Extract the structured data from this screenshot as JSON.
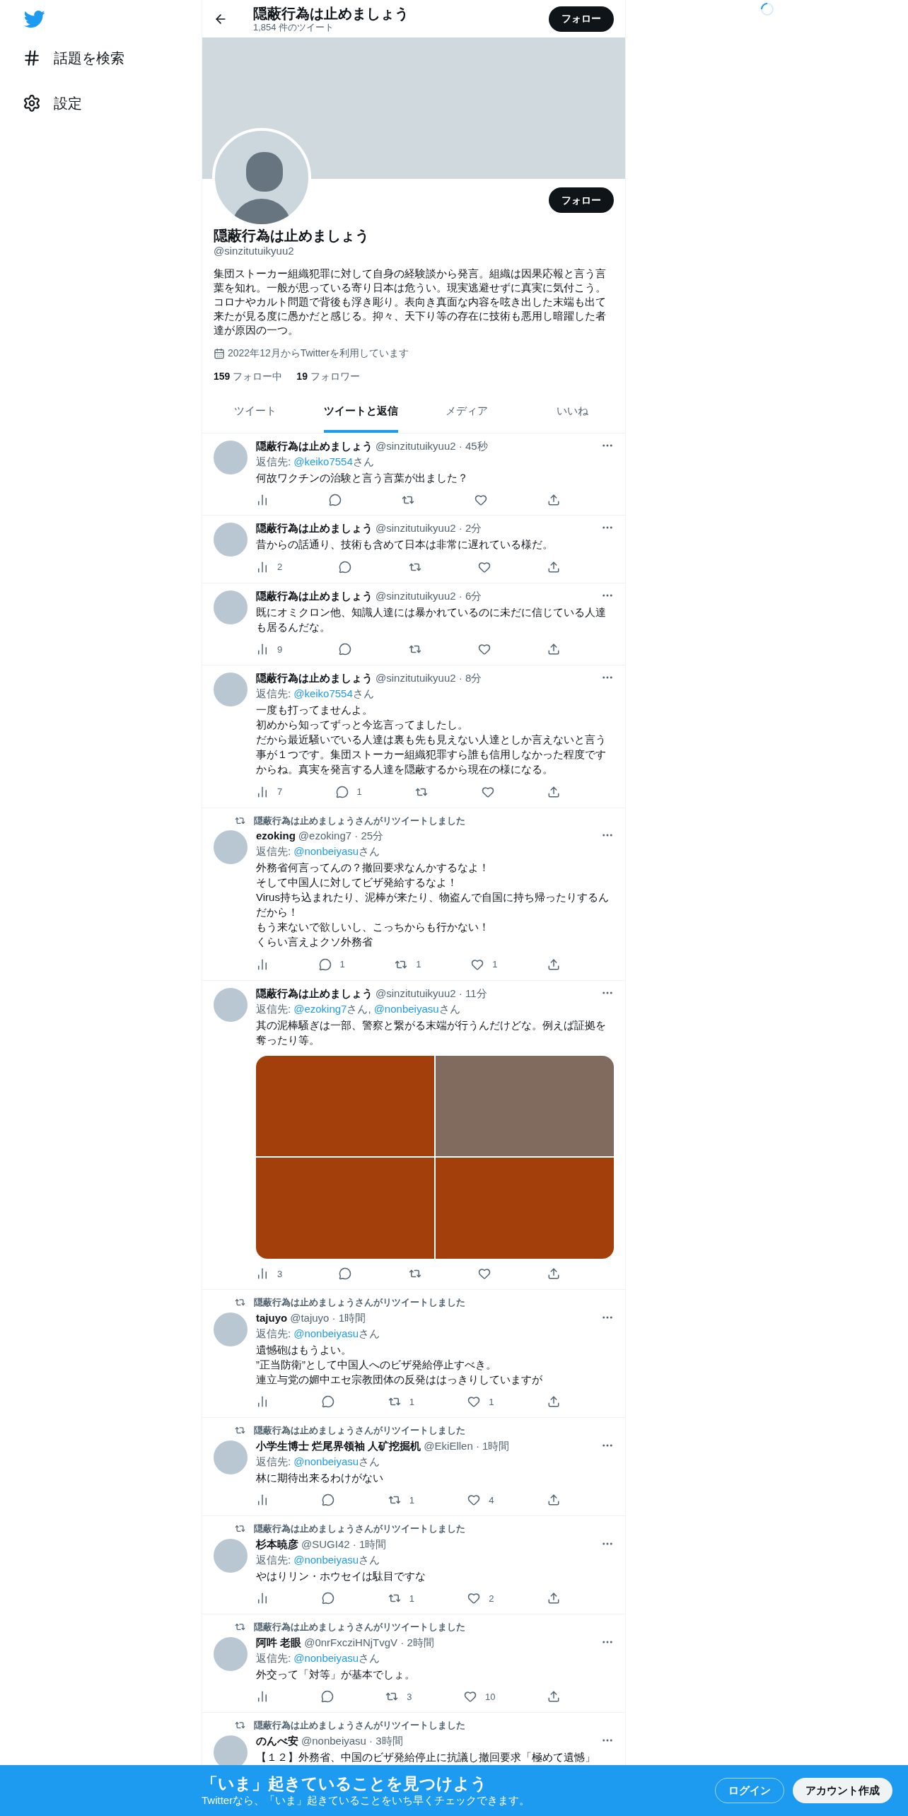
{
  "sidebar": {
    "items": [
      {
        "kind": "hashtag",
        "label": "話題を検索"
      },
      {
        "kind": "settings",
        "label": "設定"
      }
    ]
  },
  "header": {
    "title": "隠蔽行為は止めましょう",
    "tweet_count": "1,854 件のツイート",
    "follow_button": "フォロー"
  },
  "profile": {
    "follow_button": "フォロー",
    "name": "隠蔽行為は止めましょう",
    "handle": "@sinzitutuikyuu2",
    "bio": "集団ストーカー組織犯罪に対して自身の経験談から発言。組織は因果応報と言う言葉を知れ。一般が思っている寄り日本は危うい。現実逃避せずに真実に気付こう。コロナやカルト問題で背後も浮き彫り。表向き真面な内容を呟き出した末端も出て来たが見る度に愚かだと感じる。抑々、天下り等の存在に技術も悪用し暗躍した者達が原因の一つ。",
    "joined": "2022年12月からTwitterを利用しています",
    "following_count": "159",
    "following_label": "フォロー中",
    "followers_count": "19",
    "followers_label": "フォロワー"
  },
  "tabs": [
    {
      "label": "ツイート",
      "selected": false
    },
    {
      "label": "ツイートと返信",
      "selected": true
    },
    {
      "label": "メディア",
      "selected": false
    },
    {
      "label": "いいね",
      "selected": false
    }
  ],
  "tweets": [
    {
      "name": "隠蔽行為は止めましょう",
      "meta": "@sinzitutuikyuu2 · 45秒",
      "reply_label": "返信先:",
      "reply_to": [
        {
          "handle": "@keiko7554",
          "suffix": "さん"
        }
      ],
      "text": "何故ワクチンの治験と言う言葉が出ました？",
      "actions": [
        {
          "kind": "views"
        },
        {
          "kind": "reply"
        },
        {
          "kind": "retweet"
        },
        {
          "kind": "like"
        },
        {
          "kind": "share"
        }
      ]
    },
    {
      "name": "隠蔽行為は止めましょう",
      "meta": "@sinzitutuikyuu2 · 2分",
      "text": "昔からの話通り、技術も含めて日本は非常に遅れている様だ。",
      "actions": [
        {
          "kind": "views",
          "count": "2"
        },
        {
          "kind": "reply"
        },
        {
          "kind": "retweet"
        },
        {
          "kind": "like"
        },
        {
          "kind": "share"
        }
      ]
    },
    {
      "name": "隠蔽行為は止めましょう",
      "meta": "@sinzitutuikyuu2 · 6分",
      "text": "既にオミクロン他、知識人達には暴かれているのに未だに信じている人達も居るんだな。",
      "actions": [
        {
          "kind": "views",
          "count": "9"
        },
        {
          "kind": "reply"
        },
        {
          "kind": "retweet"
        },
        {
          "kind": "like"
        },
        {
          "kind": "share"
        }
      ]
    },
    {
      "name": "隠蔽行為は止めましょう",
      "meta": "@sinzitutuikyuu2 · 8分",
      "reply_label": "返信先:",
      "reply_to": [
        {
          "handle": "@keiko7554",
          "suffix": "さん"
        }
      ],
      "lines": [
        "一度も打ってませんよ。",
        "初めから知ってずっと今迄言ってましたし。",
        "だから最近騒いでいる人達は裏も先も見えない人達としか言えないと言う事が１つです。集団ストーカー組織犯罪すら誰も信用しなかった程度ですからね。真実を発言する人達を隠蔽するから現在の様になる。"
      ],
      "actions": [
        {
          "kind": "views",
          "count": "7"
        },
        {
          "kind": "reply",
          "count": "1"
        },
        {
          "kind": "retweet"
        },
        {
          "kind": "like"
        },
        {
          "kind": "share"
        }
      ]
    },
    {
      "retweeted_by": "隠蔽行為は止めましょうさんがリツイートしました",
      "name": "ezoking",
      "meta": "@ezoking7 · 25分",
      "reply_label": "返信先:",
      "reply_to": [
        {
          "handle": "@nonbeiyasu",
          "suffix": "さん"
        }
      ],
      "lines": [
        "外務省何言ってんの？撤回要求なんかするなよ！",
        "そして中国人に対してビザ発給するなよ！",
        "Virus持ち込まれたり、泥棒が来たり、物盗んで自国に持ち帰ったりするんだから！",
        "もう来ないで欲しいし、こっちからも行かない！",
        "くらい言えよクソ外務省"
      ],
      "actions": [
        {
          "kind": "views"
        },
        {
          "kind": "reply",
          "count": "1"
        },
        {
          "kind": "retweet",
          "count": "1"
        },
        {
          "kind": "like",
          "count": "1"
        },
        {
          "kind": "share"
        }
      ]
    },
    {
      "name": "隠蔽行為は止めましょう",
      "meta": "@sinzitutuikyuu2 · 11分",
      "reply_label": "返信先:",
      "reply_to": [
        {
          "handle": "@ezoking7",
          "suffix": "さん,"
        },
        {
          "handle": "@nonbeiyasu",
          "suffix": "さん"
        }
      ],
      "text": "其の泥棒騒ぎは一部、警察と繋がる末端が行うんだけどな。例えば証拠を奪ったり等。",
      "media": {
        "kind": "picture"
      },
      "actions": [
        {
          "kind": "views",
          "count": "3"
        },
        {
          "kind": "reply"
        },
        {
          "kind": "retweet"
        },
        {
          "kind": "like"
        },
        {
          "kind": "share"
        }
      ]
    },
    {
      "retweeted_by": "隠蔽行為は止めましょうさんがリツイートしました",
      "name": "tajuyo",
      "meta": "@tajuyo · 1時間",
      "reply_label": "返信先:",
      "reply_to": [
        {
          "handle": "@nonbeiyasu",
          "suffix": "さん"
        }
      ],
      "lines": [
        "遺憾砲はもうよい。",
        "”正当防衛”として中国人へのビザ発給停止すべき。",
        "連立与党の媚中エセ宗教団体の反発ははっきりしていますが"
      ],
      "actions": [
        {
          "kind": "views"
        },
        {
          "kind": "reply"
        },
        {
          "kind": "retweet",
          "count": "1"
        },
        {
          "kind": "like",
          "count": "1"
        },
        {
          "kind": "share"
        }
      ]
    },
    {
      "retweeted_by": "隠蔽行為は止めましょうさんがリツイートしました",
      "name": "小学生博士 烂尾界领袖 人矿挖掘机",
      "meta": "@EkiEllen · 1時間",
      "reply_label": "返信先:",
      "reply_to": [
        {
          "handle": "@nonbeiyasu",
          "suffix": "さん"
        }
      ],
      "text": "林に期待出来るわけがない",
      "actions": [
        {
          "kind": "views"
        },
        {
          "kind": "reply"
        },
        {
          "kind": "retweet",
          "count": "1"
        },
        {
          "kind": "like",
          "count": "4"
        },
        {
          "kind": "share"
        }
      ]
    },
    {
      "retweeted_by": "隠蔽行為は止めましょうさんがリツイートしました",
      "name": "杉本暁彦",
      "meta": "@SUGI42 · 1時間",
      "reply_label": "返信先:",
      "reply_to": [
        {
          "handle": "@nonbeiyasu",
          "suffix": "さん"
        }
      ],
      "text": "やはりリン・ホウセイは駄目ですな",
      "actions": [
        {
          "kind": "views"
        },
        {
          "kind": "reply"
        },
        {
          "kind": "retweet",
          "count": "1"
        },
        {
          "kind": "like",
          "count": "2"
        },
        {
          "kind": "share"
        }
      ]
    },
    {
      "retweeted_by": "隠蔽行為は止めましょうさんがリツイートしました",
      "name": "阿吽 老眼",
      "meta": "@0nrFxcziHNjTvgV · 2時間",
      "reply_label": "返信先:",
      "reply_to": [
        {
          "handle": "@nonbeiyasu",
          "suffix": "さん"
        }
      ],
      "text": "外交って「対等」が基本でしょ。",
      "actions": [
        {
          "kind": "views"
        },
        {
          "kind": "reply"
        },
        {
          "kind": "retweet",
          "count": "3"
        },
        {
          "kind": "like",
          "count": "10"
        },
        {
          "kind": "share"
        }
      ]
    },
    {
      "retweeted_by": "隠蔽行為は止めましょうさんがリツイートしました",
      "name": "のんべ安",
      "meta": "@nonbeiyasu · 3時間",
      "text": "【１２】外務省、中国のビザ発給停止に抗議し撤回要求「極めて遺憾」"
    }
  ],
  "signup_banner": {
    "title": "「いま」起きていることを見つけよう",
    "subtitle": "Twitterなら、「いま」起きていることをいち早くチェックできます。",
    "login_button": "ログイン",
    "signup_button": "アカウント作成"
  }
}
